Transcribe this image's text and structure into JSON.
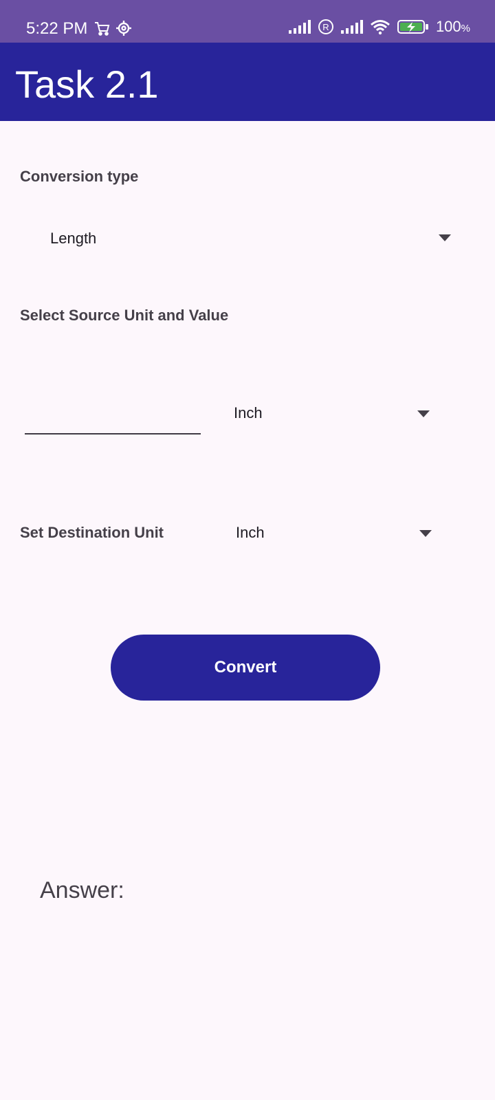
{
  "status_bar": {
    "time": "5:22 PM",
    "battery_percent": "100",
    "battery_unit": "%",
    "icons": [
      "cart-icon",
      "settings-icon",
      "signal-icon",
      "registered-icon",
      "signal-icon",
      "wifi-icon",
      "battery-charging-icon"
    ]
  },
  "app_bar": {
    "title": "Task 2.1",
    "color": "#28249a"
  },
  "conversion": {
    "label": "Conversion type",
    "selected": "Length"
  },
  "source": {
    "label": "Select Source Unit and Value",
    "value": "",
    "unit_selected": "Inch"
  },
  "destination": {
    "label": "Set Destination Unit",
    "unit_selected": "Inch"
  },
  "convert_button": {
    "label": "Convert"
  },
  "answer": {
    "label": "Answer:"
  }
}
